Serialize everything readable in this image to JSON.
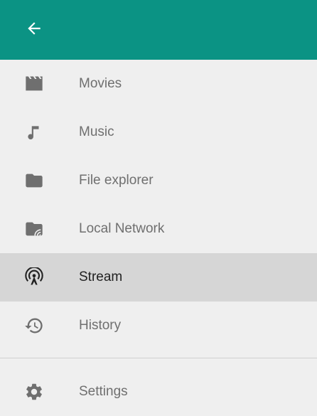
{
  "colors": {
    "header": "#0b9384",
    "background": "#efefef",
    "selected": "#d6d6d6",
    "icon": "#6f6f6f",
    "selected_icon": "#222222"
  },
  "header": {
    "back_icon": "arrow-back-icon"
  },
  "menu": {
    "items": [
      {
        "label": "Movies",
        "icon": "movie-clapper-icon",
        "selected": false
      },
      {
        "label": "Music",
        "icon": "music-note-icon",
        "selected": false
      },
      {
        "label": "File explorer",
        "icon": "folder-icon",
        "selected": false
      },
      {
        "label": "Local Network",
        "icon": "network-folder-icon",
        "selected": false
      },
      {
        "label": "Stream",
        "icon": "stream-antenna-icon",
        "selected": true
      },
      {
        "label": "History",
        "icon": "history-icon",
        "selected": false
      }
    ]
  },
  "footer": {
    "settings_label": "Settings",
    "settings_icon": "gear-icon"
  }
}
